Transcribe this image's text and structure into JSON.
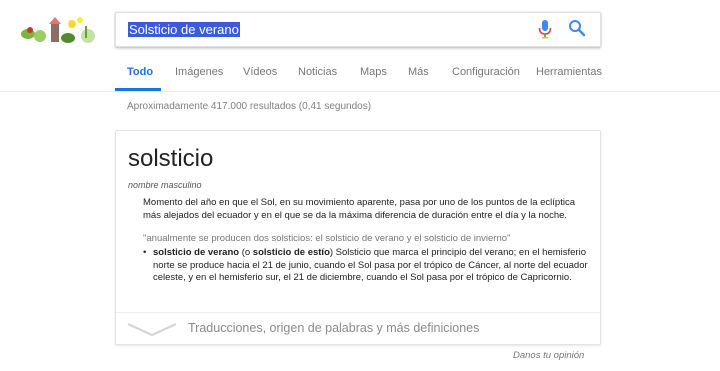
{
  "search": {
    "query": "Solsticio de verano"
  },
  "tabs": [
    {
      "label": "Todo",
      "active": true
    },
    {
      "label": "Imágenes"
    },
    {
      "label": "Vídeos"
    },
    {
      "label": "Noticias"
    },
    {
      "label": "Maps"
    },
    {
      "label": "Más"
    },
    {
      "label": "Configuración"
    },
    {
      "label": "Herramientas"
    }
  ],
  "results": {
    "stats": "Aproximadamente 417.000 resultados (0,41 segundos)"
  },
  "dictionary": {
    "word": "solsticio",
    "part_of_speech": "nombre masculino",
    "definition": "Momento del año en que el Sol, en su movimiento aparente, pasa por uno de los puntos de la eclíptica más alejados del ecuador y en el que se da la máxima diferencia de duración entre el día y la noche.",
    "example": "\"anualmente se producen dos solsticios: el solsticio de verano y el solsticio de invierno\"",
    "sub_entry": {
      "term": "solsticio de verano",
      "paren_open": " (o ",
      "alt_term": "solsticio de estío",
      "paren_close": ")",
      "text": " Solsticio que marca el principio del verano; en el hemisferio norte se produce hacia el 21 de junio, cuando el Sol pasa por el trópico de Cáncer, al norte del ecuador celeste, y en el hemisferio sur, el 21 de diciembre, cuando el Sol pasa por el trópico de Capricornio."
    },
    "more_link": "Traducciones, origen de palabras y más definiciones"
  },
  "footer": {
    "feedback": "Danos tu opinión"
  },
  "colors": {
    "accent": "#1a73e8",
    "selection": "#3b5bdb"
  }
}
